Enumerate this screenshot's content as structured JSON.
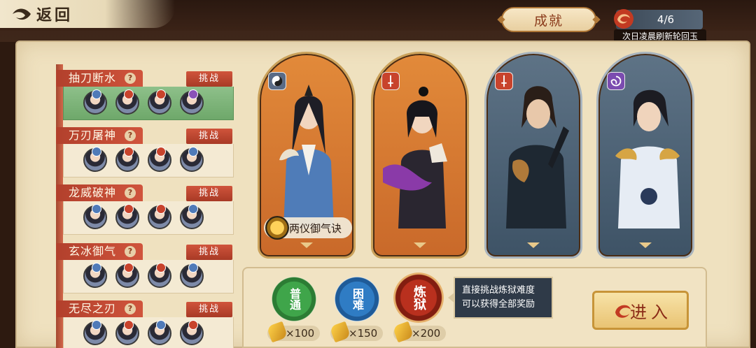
{
  "header": {
    "back_label": "返回",
    "achievement_label": "成就",
    "jade_counter": "4/6",
    "refresh_note": "次日凌晨刷新轮回玉"
  },
  "challenges": [
    {
      "title": "抽刀断水",
      "button": "挑战",
      "selected": true
    },
    {
      "title": "万刃屠神",
      "button": "挑战",
      "selected": false
    },
    {
      "title": "龙威破神",
      "button": "挑战",
      "selected": false
    },
    {
      "title": "玄冰御气",
      "button": "挑战",
      "selected": false
    },
    {
      "title": "无尽之刃",
      "button": "挑战",
      "selected": false
    }
  ],
  "help_icon_glyph": "?",
  "cards": [
    {
      "style": "orange",
      "element_icon": "yin-yang-icon",
      "skill": "两仪御气诀"
    },
    {
      "style": "orange",
      "element_icon": "sword-icon"
    },
    {
      "style": "slate",
      "element_icon": "sword-icon"
    },
    {
      "style": "slate",
      "element_icon": "swirl-icon"
    }
  ],
  "difficulty": {
    "modes": [
      {
        "label": "普通",
        "cost": "×100",
        "color": "#3fa54a"
      },
      {
        "label": "困难",
        "cost": "×150",
        "color": "#2f7cc4"
      },
      {
        "label": "炼狱",
        "cost": "×200",
        "color": "#b9301e"
      }
    ],
    "tooltip_line1": "直接挑战炼狱难度",
    "tooltip_line2": "可以获得全部奖励",
    "enter_label": "进入"
  },
  "colors": {
    "accent_red": "#c8432c",
    "parchment": "#efe1bf",
    "selected_green": "#7cb478"
  }
}
